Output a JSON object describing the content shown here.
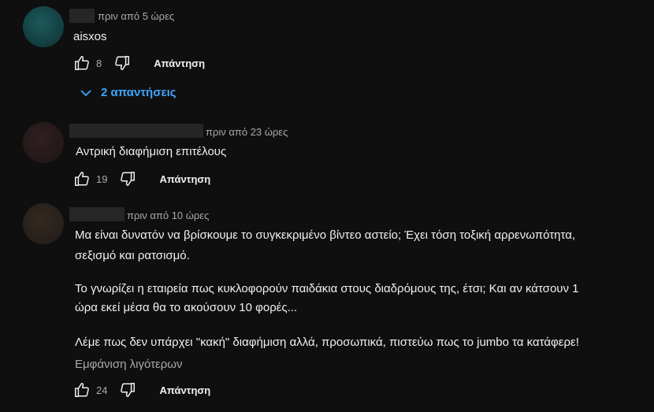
{
  "comments": [
    {
      "avatar_color": "#16474a",
      "time": "πριν από 5 ώρες",
      "text_lines": [
        "aisxos"
      ],
      "likes": "8",
      "reply_label": "Απάντηση",
      "replies_label": "2 απαντήσεις"
    },
    {
      "avatar_color": "#2a1a1a",
      "time": "πριν από 23 ώρες",
      "text_lines": [
        "Αντρική διαφήμιση επιτέλους"
      ],
      "likes": "19",
      "reply_label": "Απάντηση"
    },
    {
      "avatar_color": "#2b2220",
      "time": "πριν από 10 ώρες",
      "text_lines": [
        "Μα είναι δυνατόν να βρίσκουμε το συγκεκριμένο βίντεο αστείο; Έχει τόση τοξική αρρενωπότητα,",
        "σεξισμό και ρατσισμό.",
        "Το γνωρίζει η εταιρεία πως κυκλοφορούν παιδάκια στους διαδρόμους της, έτσι; Και αν κάτσουν 1",
        "ώρα εκεί μέσα θα το ακούσουν 10 φορές...",
        "Λέμε πως δεν υπάρχει \"κακή\" διαφήμιση αλλά, προσωπικά, πιστεύω πως το jumbo τα κατάφερε!"
      ],
      "show_less_label": "Εμφάνιση λιγότερων",
      "likes": "24",
      "reply_label": "Απάντηση"
    }
  ]
}
